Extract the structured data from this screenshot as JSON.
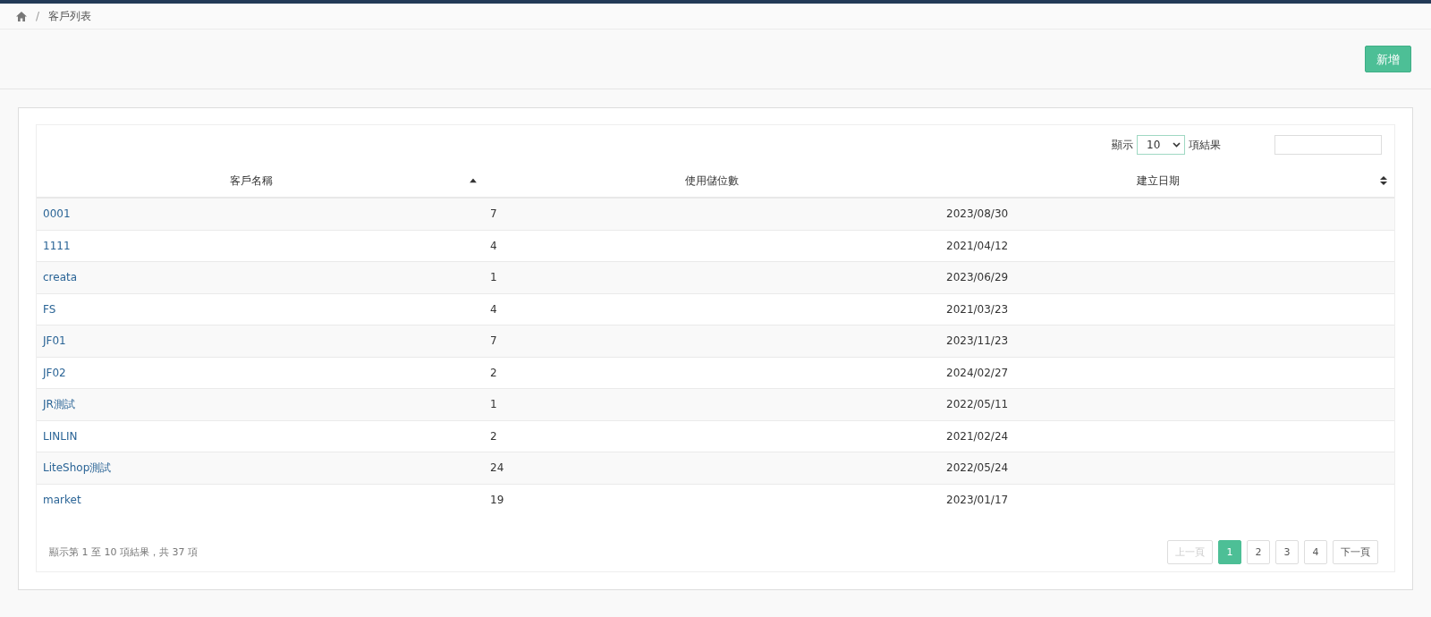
{
  "breadcrumb": {
    "separator": "/",
    "items": [
      "客戶列表"
    ]
  },
  "header": {
    "add_button": "新增"
  },
  "table": {
    "length_label_before": "顯示",
    "length_value": "10",
    "length_label_after": "項結果",
    "columns": [
      {
        "label": "客戶名稱",
        "sortable": true,
        "sorted": true
      },
      {
        "label": "使用儲位數",
        "sortable": false,
        "sorted": false
      },
      {
        "label": "建立日期",
        "sortable": true,
        "sorted": false
      }
    ],
    "rows": [
      {
        "name": "0001",
        "count": "7",
        "date": "2023/08/30"
      },
      {
        "name": "1111",
        "count": "4",
        "date": "2021/04/12"
      },
      {
        "name": "creata",
        "count": "1",
        "date": "2023/06/29"
      },
      {
        "name": "FS",
        "count": "4",
        "date": "2021/03/23"
      },
      {
        "name": "JF01",
        "count": "7",
        "date": "2023/11/23"
      },
      {
        "name": "JF02",
        "count": "2",
        "date": "2024/02/27"
      },
      {
        "name": "JR測試",
        "count": "1",
        "date": "2022/05/11"
      },
      {
        "name": "LINLIN",
        "count": "2",
        "date": "2021/02/24"
      },
      {
        "name": "LiteShop測試",
        "count": "24",
        "date": "2022/05/24"
      },
      {
        "name": "market",
        "count": "19",
        "date": "2023/01/17"
      }
    ],
    "info": "顯示第 1 至 10 項結果，共 37 項",
    "pagination": {
      "previous": {
        "label": "上一頁",
        "disabled": true
      },
      "pages": [
        {
          "label": "1",
          "selected": true
        },
        {
          "label": "2",
          "selected": false
        },
        {
          "label": "3",
          "selected": false
        },
        {
          "label": "4",
          "selected": false
        }
      ],
      "next": {
        "label": "下一頁",
        "disabled": false
      }
    }
  }
}
